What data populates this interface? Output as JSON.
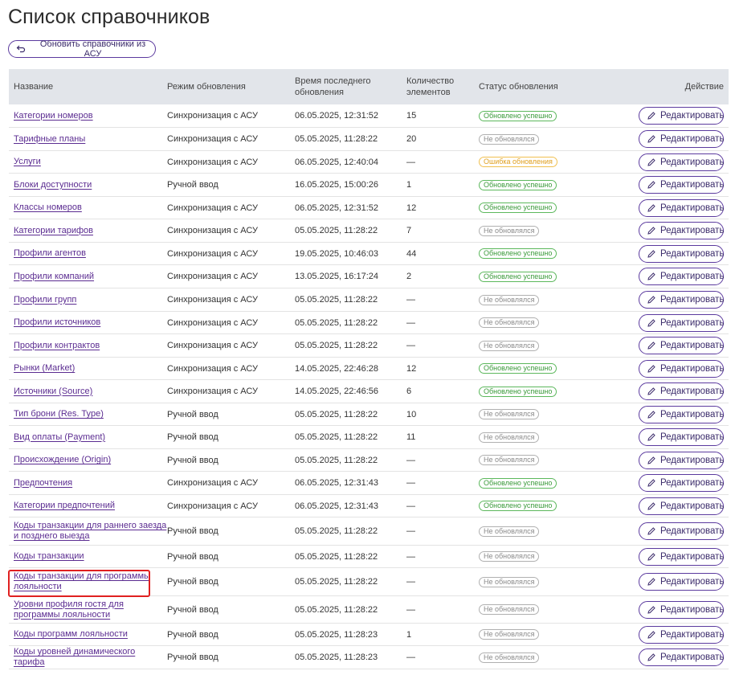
{
  "page": {
    "title": "Список справочников",
    "refresh_button": "Обновить справочники из АСУ"
  },
  "table": {
    "headers": {
      "name": "Название",
      "mode": "Режим обновления",
      "time": "Время последнего обновления",
      "count": "Количество элементов",
      "status": "Статус обновления",
      "action": "Действие"
    },
    "edit_label": "Редактировать",
    "rows": [
      {
        "name": "Категории номеров",
        "mode": "Синхронизация с АСУ",
        "time": "06.05.2025, 12:31:52",
        "count": "15",
        "status": "Обновлено успешно",
        "status_kind": "ok"
      },
      {
        "name": "Тарифные планы",
        "mode": "Синхронизация с АСУ",
        "time": "05.05.2025, 11:28:22",
        "count": "20",
        "status": "Не обновлялся",
        "status_kind": "none"
      },
      {
        "name": "Услуги",
        "mode": "Синхронизация с АСУ",
        "time": "06.05.2025, 12:40:04",
        "count": "—",
        "status": "Ошибка обновления",
        "status_kind": "err"
      },
      {
        "name": "Блоки доступности",
        "mode": "Ручной ввод",
        "time": "16.05.2025, 15:00:26",
        "count": "1",
        "status": "Обновлено успешно",
        "status_kind": "ok"
      },
      {
        "name": "Классы номеров",
        "mode": "Синхронизация с АСУ",
        "time": "06.05.2025, 12:31:52",
        "count": "12",
        "status": "Обновлено успешно",
        "status_kind": "ok"
      },
      {
        "name": "Категории тарифов",
        "mode": "Синхронизация с АСУ",
        "time": "05.05.2025, 11:28:22",
        "count": "7",
        "status": "Не обновлялся",
        "status_kind": "none"
      },
      {
        "name": "Профили агентов",
        "mode": "Синхронизация с АСУ",
        "time": "19.05.2025, 10:46:03",
        "count": "44",
        "status": "Обновлено успешно",
        "status_kind": "ok"
      },
      {
        "name": "Профили компаний",
        "mode": "Синхронизация с АСУ",
        "time": "13.05.2025, 16:17:24",
        "count": "2",
        "status": "Обновлено успешно",
        "status_kind": "ok"
      },
      {
        "name": "Профили групп",
        "mode": "Синхронизация с АСУ",
        "time": "05.05.2025, 11:28:22",
        "count": "—",
        "status": "Не обновлялся",
        "status_kind": "none"
      },
      {
        "name": "Профили источников",
        "mode": "Синхронизация с АСУ",
        "time": "05.05.2025, 11:28:22",
        "count": "—",
        "status": "Не обновлялся",
        "status_kind": "none"
      },
      {
        "name": "Профили контрактов",
        "mode": "Синхронизация с АСУ",
        "time": "05.05.2025, 11:28:22",
        "count": "—",
        "status": "Не обновлялся",
        "status_kind": "none"
      },
      {
        "name": "Рынки (Market)",
        "mode": "Синхронизация с АСУ",
        "time": "14.05.2025, 22:46:28",
        "count": "12",
        "status": "Обновлено успешно",
        "status_kind": "ok"
      },
      {
        "name": "Источники (Source)",
        "mode": "Синхронизация с АСУ",
        "time": "14.05.2025, 22:46:56",
        "count": "6",
        "status": "Обновлено успешно",
        "status_kind": "ok"
      },
      {
        "name": "Тип брони (Res. Type)",
        "mode": "Ручной ввод",
        "time": "05.05.2025, 11:28:22",
        "count": "10",
        "status": "Не обновлялся",
        "status_kind": "none"
      },
      {
        "name": "Вид оплаты (Payment)",
        "mode": "Ручной ввод",
        "time": "05.05.2025, 11:28:22",
        "count": "11",
        "status": "Не обновлялся",
        "status_kind": "none"
      },
      {
        "name": "Происхождение (Origin)",
        "mode": "Ручной ввод",
        "time": "05.05.2025, 11:28:22",
        "count": "—",
        "status": "Не обновлялся",
        "status_kind": "none"
      },
      {
        "name": "Предпочтения",
        "mode": "Синхронизация с АСУ",
        "time": "06.05.2025, 12:31:43",
        "count": "—",
        "status": "Обновлено успешно",
        "status_kind": "ok"
      },
      {
        "name": "Категории предпочтений",
        "mode": "Синхронизация с АСУ",
        "time": "06.05.2025, 12:31:43",
        "count": "—",
        "status": "Обновлено успешно",
        "status_kind": "ok"
      },
      {
        "name": "Коды транзакции для раннего заезда и позднего выезда",
        "mode": "Ручной ввод",
        "time": "05.05.2025, 11:28:22",
        "count": "—",
        "status": "Не обновлялся",
        "status_kind": "none"
      },
      {
        "name": "Коды транзакции",
        "mode": "Ручной ввод",
        "time": "05.05.2025, 11:28:22",
        "count": "—",
        "status": "Не обновлялся",
        "status_kind": "none"
      },
      {
        "name": "Коды транзакции для программы лояльности",
        "mode": "Ручной ввод",
        "time": "05.05.2025, 11:28:22",
        "count": "—",
        "status": "Не обновлялся",
        "status_kind": "none"
      },
      {
        "name": "Уровни профиля гостя для программы лояльности",
        "mode": "Ручной ввод",
        "time": "05.05.2025, 11:28:22",
        "count": "—",
        "status": "Не обновлялся",
        "status_kind": "none"
      },
      {
        "name": "Коды программ лояльности",
        "mode": "Ручной ввод",
        "time": "05.05.2025, 11:28:23",
        "count": "1",
        "status": "Не обновлялся",
        "status_kind": "none"
      },
      {
        "name": "Коды уровней динамического тарифа",
        "mode": "Ручной ввод",
        "time": "05.05.2025, 11:28:23",
        "count": "—",
        "status": "Не обновлялся",
        "status_kind": "none"
      }
    ]
  },
  "icons": {
    "refresh": "undo-arrow-icon",
    "edit": "pencil-icon"
  },
  "colors": {
    "accent": "#5b3a9e",
    "link": "#5b2c91",
    "ok": "#5cb85c",
    "none": "#b0b0b0",
    "err": "#f0c050",
    "highlight": "#e02020"
  }
}
